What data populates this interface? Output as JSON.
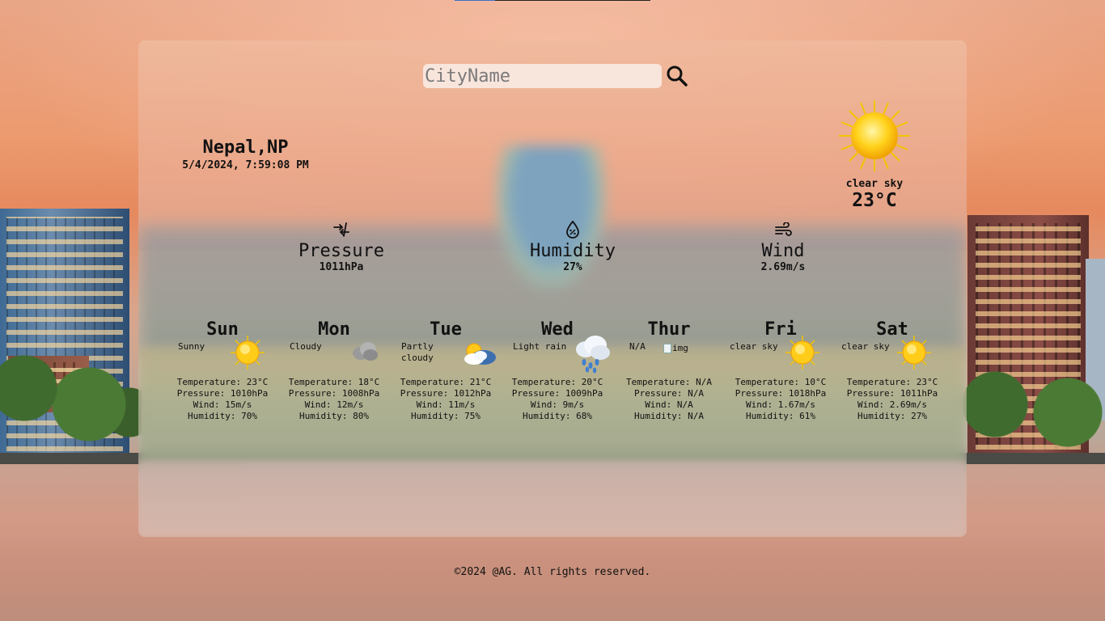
{
  "search": {
    "placeholder": "CityName",
    "value": ""
  },
  "location": {
    "city": "Nepal,NP",
    "datetime": "5/4/2024, 7:59:08 PM"
  },
  "current": {
    "description": "clear sky",
    "temperature": "23°C",
    "icon": "sun-icon"
  },
  "stats": {
    "pressure": {
      "label": "Pressure",
      "value": "1011hPa",
      "icon": "pressure-arrows-icon"
    },
    "humidity": {
      "label": "Humidity",
      "value": "27%",
      "icon": "humidity-drop-icon"
    },
    "wind": {
      "label": "Wind",
      "value": "2.69m/s",
      "icon": "wind-icon"
    }
  },
  "forecast": [
    {
      "day": "Sun",
      "description": "Sunny",
      "icon": "sun-icon",
      "temperature": "Temperature: 23°C",
      "pressure": "Pressure: 1010hPa",
      "wind": "Wind: 15m/s",
      "humidity": "Humidity: 70%"
    },
    {
      "day": "Mon",
      "description": "Cloudy",
      "icon": "cloud-icon",
      "temperature": "Temperature: 18°C",
      "pressure": "Pressure: 1008hPa",
      "wind": "Wind: 12m/s",
      "humidity": "Humidity: 80%"
    },
    {
      "day": "Tue",
      "description": "Partly cloudy",
      "icon": "partly-cloudy-icon",
      "temperature": "Temperature: 21°C",
      "pressure": "Pressure: 1012hPa",
      "wind": "Wind: 11m/s",
      "humidity": "Humidity: 75%"
    },
    {
      "day": "Wed",
      "description": "Light rain",
      "icon": "rain-icon",
      "temperature": "Temperature: 20°C",
      "pressure": "Pressure: 1009hPa",
      "wind": "Wind: 9m/s",
      "humidity": "Humidity: 68%"
    },
    {
      "day": "Thur",
      "description": "N/A",
      "icon": "broken-image-icon",
      "icon_alt": "img",
      "temperature": "Temperature: N/A",
      "pressure": "Pressure: N/A",
      "wind": "Wind: N/A",
      "humidity": "Humidity: N/A"
    },
    {
      "day": "Fri",
      "description": "clear sky",
      "icon": "sun-icon",
      "temperature": "Temperature: 10°C",
      "pressure": "Pressure: 1018hPa",
      "wind": "Wind: 1.67m/s",
      "humidity": "Humidity: 61%"
    },
    {
      "day": "Sat",
      "description": "clear sky",
      "icon": "sun-icon",
      "temperature": "Temperature: 23°C",
      "pressure": "Pressure: 1011hPa",
      "wind": "Wind: 2.69m/s",
      "humidity": "Humidity: 27%"
    }
  ],
  "footer": {
    "text": "©2024 @AG. All rights reserved."
  }
}
